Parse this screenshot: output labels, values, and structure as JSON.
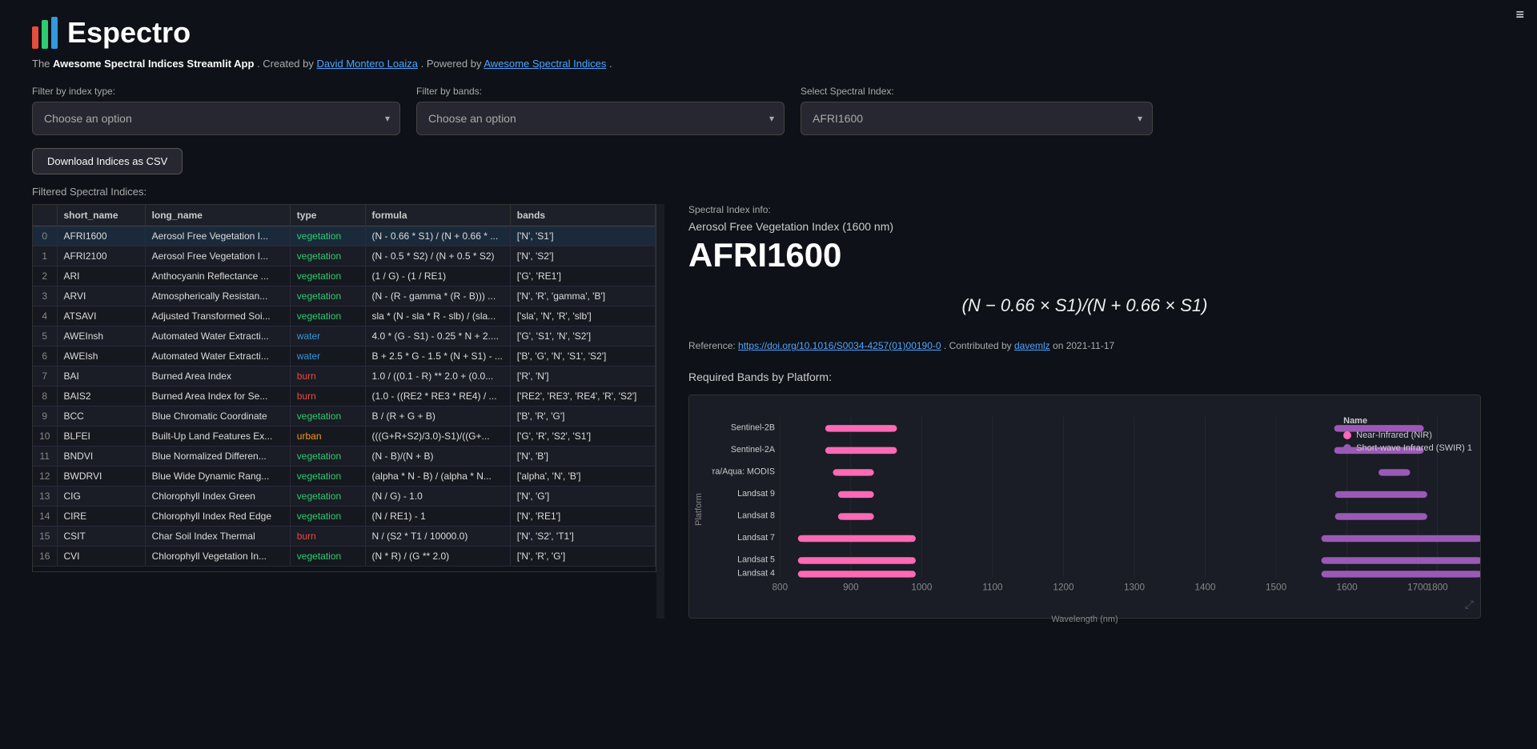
{
  "app": {
    "title": "Espectro",
    "subtitle_pre": "The ",
    "subtitle_bold": "Awesome Spectral Indices Streamlit App",
    "subtitle_mid": ". Created by ",
    "creator_link": "David Montero Loaiza",
    "creator_url": "https://github.com/davemlz",
    "subtitle_mid2": ". Powered by ",
    "powered_link": "Awesome Spectral Indices",
    "powered_url": "https://github.com/davemlz/awesome-spectral-indices",
    "subtitle_end": "."
  },
  "filters": {
    "index_type_label": "Filter by index type:",
    "index_type_placeholder": "Choose an option",
    "bands_label": "Filter by bands:",
    "bands_placeholder": "Choose an option",
    "spectral_label": "Select Spectral Index:",
    "spectral_value": "AFRI1600"
  },
  "download_btn": "Download Indices as CSV",
  "filtered_label": "Filtered Spectral Indices:",
  "table": {
    "columns": [
      "",
      "short_name",
      "long_name",
      "type",
      "formula",
      "bands"
    ],
    "rows": [
      [
        "0",
        "AFRI1600",
        "Aerosol Free Vegetation I...",
        "vegetation",
        "(N - 0.66 * S1) / (N + 0.66 * ...",
        "['N', 'S1']"
      ],
      [
        "1",
        "AFRI2100",
        "Aerosol Free Vegetation I...",
        "vegetation",
        "(N - 0.5 * S2) / (N + 0.5 * S2)",
        "['N', 'S2']"
      ],
      [
        "2",
        "ARI",
        "Anthocyanin Reflectance ...",
        "vegetation",
        "(1 / G) - (1 / RE1)",
        "['G', 'RE1']"
      ],
      [
        "3",
        "ARVI",
        "Atmospherically Resistan...",
        "vegetation",
        "(N - (R - gamma * (R - B))) ...",
        "['N', 'R', 'gamma', 'B']"
      ],
      [
        "4",
        "ATSAVI",
        "Adjusted Transformed Soi...",
        "vegetation",
        "sla * (N - sla * R - slb) / (sla...",
        "['sla', 'N', 'R', 'slb']"
      ],
      [
        "5",
        "AWEInsh",
        "Automated Water Extracti...",
        "water",
        "4.0 * (G - S1) - 0.25 * N + 2....",
        "['G', 'S1', 'N', 'S2']"
      ],
      [
        "6",
        "AWEIsh",
        "Automated Water Extracti...",
        "water",
        "B + 2.5 * G - 1.5 * (N + S1) - ...",
        "['B', 'G', 'N', 'S1', 'S2']"
      ],
      [
        "7",
        "BAI",
        "Burned Area Index",
        "burn",
        "1.0 / ((0.1 - R) ** 2.0 + (0.0...",
        "['R', 'N']"
      ],
      [
        "8",
        "BAIS2",
        "Burned Area Index for Se...",
        "burn",
        "(1.0 - ((RE2 * RE3 * RE4) / ...",
        "['RE2', 'RE3', 'RE4', 'R', 'S2']"
      ],
      [
        "9",
        "BCC",
        "Blue Chromatic Coordinate",
        "vegetation",
        "B / (R + G + B)",
        "['B', 'R', 'G']"
      ],
      [
        "10",
        "BLFEI",
        "Built-Up Land Features Ex...",
        "urban",
        "(((G+R+S2)/3.0)-S1)/((G+...",
        "['G', 'R', 'S2', 'S1']"
      ],
      [
        "11",
        "BNDVI",
        "Blue Normalized Differen...",
        "vegetation",
        "(N - B)/(N + B)",
        "['N', 'B']"
      ],
      [
        "12",
        "BWDRVI",
        "Blue Wide Dynamic Rang...",
        "vegetation",
        "(alpha * N - B) / (alpha * N...",
        "['alpha', 'N', 'B']"
      ],
      [
        "13",
        "CIG",
        "Chlorophyll Index Green",
        "vegetation",
        "(N / G) - 1.0",
        "['N', 'G']"
      ],
      [
        "14",
        "CIRE",
        "Chlorophyll Index Red Edge",
        "vegetation",
        "(N / RE1) - 1",
        "['N', 'RE1']"
      ],
      [
        "15",
        "CSIT",
        "Char Soil Index Thermal",
        "burn",
        "N / (S2 * T1 / 10000.0)",
        "['N', 'S2', 'T1']"
      ],
      [
        "16",
        "CVI",
        "Chlorophyll Vegetation In...",
        "vegetation",
        "(N * R) / (G ** 2.0)",
        "['N', 'R', 'G']"
      ]
    ]
  },
  "spectral_info": {
    "section_label": "Spectral Index info:",
    "full_name": "Aerosol Free Vegetation Index (1600 nm)",
    "short_name": "AFRI1600",
    "formula_display": "(N − 0.66 × S1)/(N + 0.66 × S1)",
    "reference_pre": "Reference: ",
    "reference_url": "https://doi.org/10.1016/S0034-4257(01)00190-0",
    "reference_link_text": "https://doi.org/10.1016/S0034-4257(01)00190-0",
    "reference_mid": ". Contributed by ",
    "contributor_link": "davemlz",
    "contributor_url": "https://github.com/davemlz",
    "reference_end": " on 2021-11-17"
  },
  "chart": {
    "title": "Required Bands by Platform:",
    "x_label": "Wavelength (nm)",
    "y_label": "Platform",
    "legend_title": "Name",
    "legend_items": [
      {
        "label": "Near-Infrared (NIR)",
        "color": "#ff69b4"
      },
      {
        "label": "Short-wave Infrared (SWIR) 1",
        "color": "#9b59b6"
      }
    ],
    "platforms": [
      "Sentinel-2B",
      "Sentinel-2A",
      "Terra/Aqua: MODIS",
      "Landsat 9",
      "Landsat 8",
      "Landsat 7",
      "Landsat 5",
      "Landsat 4"
    ],
    "x_ticks": [
      "800",
      "900",
      "1000",
      "1100",
      "1200",
      "1300",
      "1400",
      "1500",
      "1600",
      "1700",
      "1800"
    ],
    "nir_ranges": [
      [
        832,
        898
      ],
      [
        832,
        898
      ],
      [
        841,
        876
      ],
      [
        850,
        880
      ],
      [
        850,
        880
      ],
      [
        770,
        900
      ],
      [
        770,
        900
      ],
      [
        770,
        900
      ]
    ],
    "swir_ranges": [
      [
        1565,
        1655
      ],
      [
        1565,
        1655
      ],
      [
        1628,
        1652
      ],
      [
        1566,
        1651
      ],
      [
        1566,
        1651
      ],
      [
        1550,
        1750
      ],
      [
        1550,
        1750
      ],
      [
        1550,
        1750
      ]
    ]
  },
  "icons": {
    "hamburger": "≡",
    "dropdown_arrow": "▾",
    "expand": "⤢",
    "scrollbar_handle": "▌"
  }
}
